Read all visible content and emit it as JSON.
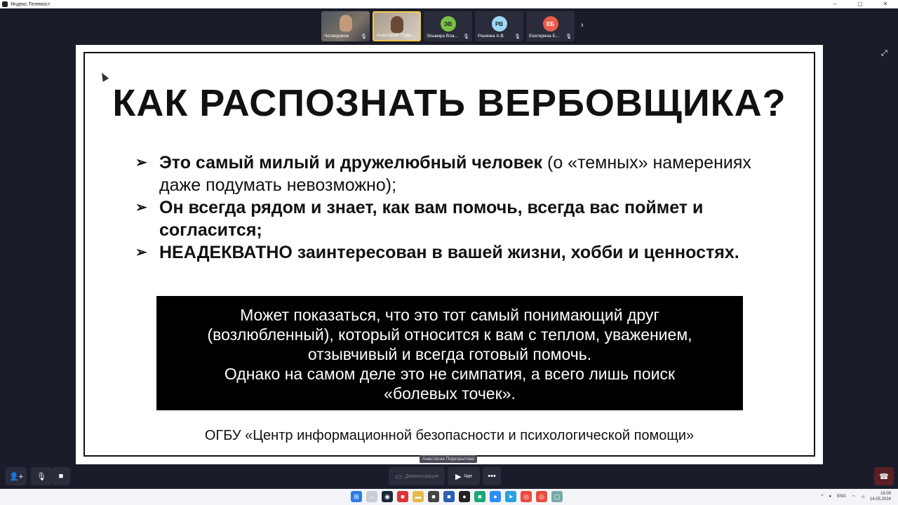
{
  "window": {
    "title": "Яндекс.Телемост",
    "minimize": "–",
    "maximize": "▢",
    "close": "✕"
  },
  "participants": [
    {
      "name": "Четвериков",
      "type": "video"
    },
    {
      "name": "Анастасия Подк...",
      "type": "video-active"
    },
    {
      "name": "Эльвира Вла...",
      "initials": "ЭВ",
      "color": "#7bc043"
    },
    {
      "name": "Разинка А.В.",
      "initials": "РВ",
      "color": "#9ed8f5"
    },
    {
      "name": "Екатерина Б...",
      "initials": "ЕБ",
      "color": "#e85c4a"
    }
  ],
  "icons": {
    "mic_off": "🎙",
    "chevron": "›",
    "expand": "⤢"
  },
  "slide": {
    "heading": "КАК РАСПОЗНАТЬ ВЕРБОВЩИКА?",
    "bullet_mark": "➢",
    "bullets": [
      {
        "bold": "Это самый милый и дружелюбный человек",
        "normal": " (о «темных» намерениях даже подумать невозможно);"
      },
      {
        "bold": "Он всегда рядом и знает, как вам помочь, всегда вас поймет и согласится;",
        "normal": ""
      },
      {
        "bold": "НЕАДЕКВАТНО заинтересован в вашей жизни, хобби и ценностях.",
        "normal": ""
      }
    ],
    "quote_lines": [
      "Может показаться, что это тот самый понимающий друг",
      "(возлюбленный), который относится к вам с теплом, уважением,",
      "отзывчивый и всегда готовый помочь.",
      "Однако на самом деле это не симпатия, а всего лишь поиск",
      "«болевых точек»."
    ],
    "footer": "ОГБУ «Центр информационной безопасности и психологической помощи»"
  },
  "tooltip": "Анастасия Подкорытова",
  "controls": {
    "add_user": "👤+",
    "mic": "🎙",
    "camera": "■",
    "demo": "Демонстрация",
    "chat": "Чат",
    "more": "•••",
    "hangup": "☎"
  },
  "taskbar": {
    "lang": "ENG",
    "time": "16:09",
    "date": "14.05.2024"
  }
}
